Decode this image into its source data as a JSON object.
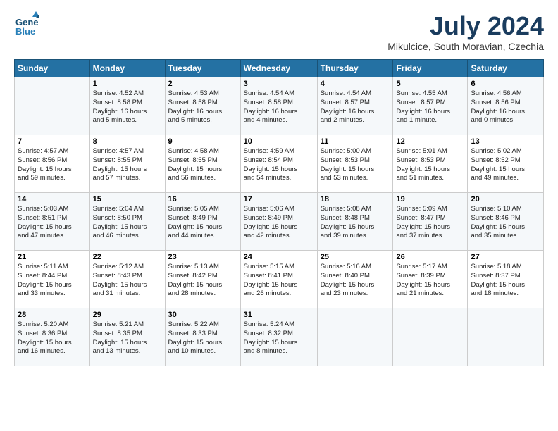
{
  "header": {
    "logo_line1": "General",
    "logo_line2": "Blue",
    "month": "July 2024",
    "location": "Mikulcice, South Moravian, Czechia"
  },
  "days_of_week": [
    "Sunday",
    "Monday",
    "Tuesday",
    "Wednesday",
    "Thursday",
    "Friday",
    "Saturday"
  ],
  "weeks": [
    [
      {
        "day": "",
        "info": ""
      },
      {
        "day": "1",
        "info": "Sunrise: 4:52 AM\nSunset: 8:58 PM\nDaylight: 16 hours\nand 5 minutes."
      },
      {
        "day": "2",
        "info": "Sunrise: 4:53 AM\nSunset: 8:58 PM\nDaylight: 16 hours\nand 5 minutes."
      },
      {
        "day": "3",
        "info": "Sunrise: 4:54 AM\nSunset: 8:58 PM\nDaylight: 16 hours\nand 4 minutes."
      },
      {
        "day": "4",
        "info": "Sunrise: 4:54 AM\nSunset: 8:57 PM\nDaylight: 16 hours\nand 2 minutes."
      },
      {
        "day": "5",
        "info": "Sunrise: 4:55 AM\nSunset: 8:57 PM\nDaylight: 16 hours\nand 1 minute."
      },
      {
        "day": "6",
        "info": "Sunrise: 4:56 AM\nSunset: 8:56 PM\nDaylight: 16 hours\nand 0 minutes."
      }
    ],
    [
      {
        "day": "7",
        "info": "Sunrise: 4:57 AM\nSunset: 8:56 PM\nDaylight: 15 hours\nand 59 minutes."
      },
      {
        "day": "8",
        "info": "Sunrise: 4:57 AM\nSunset: 8:55 PM\nDaylight: 15 hours\nand 57 minutes."
      },
      {
        "day": "9",
        "info": "Sunrise: 4:58 AM\nSunset: 8:55 PM\nDaylight: 15 hours\nand 56 minutes."
      },
      {
        "day": "10",
        "info": "Sunrise: 4:59 AM\nSunset: 8:54 PM\nDaylight: 15 hours\nand 54 minutes."
      },
      {
        "day": "11",
        "info": "Sunrise: 5:00 AM\nSunset: 8:53 PM\nDaylight: 15 hours\nand 53 minutes."
      },
      {
        "day": "12",
        "info": "Sunrise: 5:01 AM\nSunset: 8:53 PM\nDaylight: 15 hours\nand 51 minutes."
      },
      {
        "day": "13",
        "info": "Sunrise: 5:02 AM\nSunset: 8:52 PM\nDaylight: 15 hours\nand 49 minutes."
      }
    ],
    [
      {
        "day": "14",
        "info": "Sunrise: 5:03 AM\nSunset: 8:51 PM\nDaylight: 15 hours\nand 47 minutes."
      },
      {
        "day": "15",
        "info": "Sunrise: 5:04 AM\nSunset: 8:50 PM\nDaylight: 15 hours\nand 46 minutes."
      },
      {
        "day": "16",
        "info": "Sunrise: 5:05 AM\nSunset: 8:49 PM\nDaylight: 15 hours\nand 44 minutes."
      },
      {
        "day": "17",
        "info": "Sunrise: 5:06 AM\nSunset: 8:49 PM\nDaylight: 15 hours\nand 42 minutes."
      },
      {
        "day": "18",
        "info": "Sunrise: 5:08 AM\nSunset: 8:48 PM\nDaylight: 15 hours\nand 39 minutes."
      },
      {
        "day": "19",
        "info": "Sunrise: 5:09 AM\nSunset: 8:47 PM\nDaylight: 15 hours\nand 37 minutes."
      },
      {
        "day": "20",
        "info": "Sunrise: 5:10 AM\nSunset: 8:46 PM\nDaylight: 15 hours\nand 35 minutes."
      }
    ],
    [
      {
        "day": "21",
        "info": "Sunrise: 5:11 AM\nSunset: 8:44 PM\nDaylight: 15 hours\nand 33 minutes."
      },
      {
        "day": "22",
        "info": "Sunrise: 5:12 AM\nSunset: 8:43 PM\nDaylight: 15 hours\nand 31 minutes."
      },
      {
        "day": "23",
        "info": "Sunrise: 5:13 AM\nSunset: 8:42 PM\nDaylight: 15 hours\nand 28 minutes."
      },
      {
        "day": "24",
        "info": "Sunrise: 5:15 AM\nSunset: 8:41 PM\nDaylight: 15 hours\nand 26 minutes."
      },
      {
        "day": "25",
        "info": "Sunrise: 5:16 AM\nSunset: 8:40 PM\nDaylight: 15 hours\nand 23 minutes."
      },
      {
        "day": "26",
        "info": "Sunrise: 5:17 AM\nSunset: 8:39 PM\nDaylight: 15 hours\nand 21 minutes."
      },
      {
        "day": "27",
        "info": "Sunrise: 5:18 AM\nSunset: 8:37 PM\nDaylight: 15 hours\nand 18 minutes."
      }
    ],
    [
      {
        "day": "28",
        "info": "Sunrise: 5:20 AM\nSunset: 8:36 PM\nDaylight: 15 hours\nand 16 minutes."
      },
      {
        "day": "29",
        "info": "Sunrise: 5:21 AM\nSunset: 8:35 PM\nDaylight: 15 hours\nand 13 minutes."
      },
      {
        "day": "30",
        "info": "Sunrise: 5:22 AM\nSunset: 8:33 PM\nDaylight: 15 hours\nand 10 minutes."
      },
      {
        "day": "31",
        "info": "Sunrise: 5:24 AM\nSunset: 8:32 PM\nDaylight: 15 hours\nand 8 minutes."
      },
      {
        "day": "",
        "info": ""
      },
      {
        "day": "",
        "info": ""
      },
      {
        "day": "",
        "info": ""
      }
    ]
  ]
}
